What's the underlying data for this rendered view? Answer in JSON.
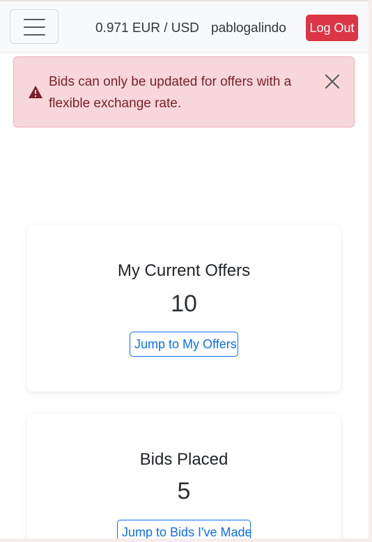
{
  "navbar": {
    "menu_icon": "hamburger-menu-icon",
    "exchange_rate": "0.971 EUR / USD",
    "username": "pablogalindo",
    "logout_label": "Log Out"
  },
  "alert": {
    "icon": "warning-triangle-icon",
    "message": "Bids can only be updated for offers with a flexible exchange rate.",
    "close_icon": "close-icon"
  },
  "cards": {
    "offers": {
      "title": "My Current Offers",
      "count": "10",
      "button_label": "Jump to My Offers"
    },
    "bids": {
      "title": "Bids Placed",
      "count": "5",
      "button_label": "Jump to Bids I've Made"
    }
  },
  "colors": {
    "danger": "#dc3545",
    "primary": "#0d6efd",
    "alert_bg": "#f8d7da",
    "alert_text": "#7a1f28",
    "navbar_bg": "#f8f9fa"
  }
}
